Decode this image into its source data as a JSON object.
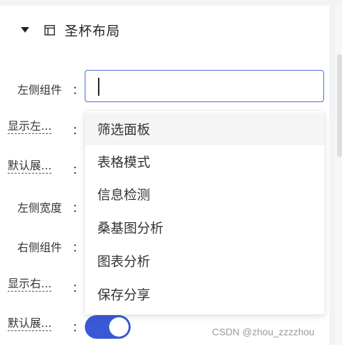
{
  "section": {
    "title": "圣杯布局"
  },
  "form": {
    "colon": "：",
    "rows": [
      {
        "label": "左侧组件"
      },
      {
        "label": "显示左..."
      },
      {
        "label": "默认展..."
      },
      {
        "label": "左侧宽度"
      },
      {
        "label": "右侧组件"
      },
      {
        "label": "显示右..."
      },
      {
        "label": "默认展..."
      }
    ],
    "left_component_input": {
      "value": ""
    },
    "default_expand_toggle": {
      "on": true,
      "accent": "#3a59d6"
    }
  },
  "dropdown": {
    "options": [
      "筛选面板",
      "表格模式",
      "信息检测",
      "桑基图分析",
      "图表分析",
      "保存分享"
    ],
    "highlighted_index": 0
  },
  "watermark": "CSDN @zhou_zzzzhou"
}
